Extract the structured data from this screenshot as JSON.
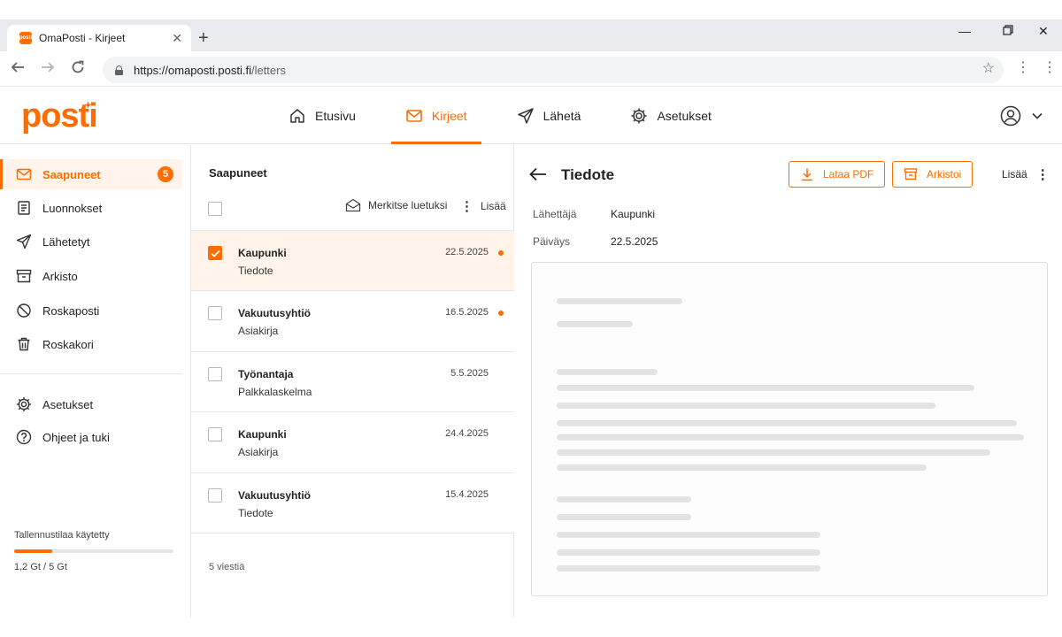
{
  "browser": {
    "tab_title": "OmaPosti - Kirjeet",
    "favicon_text": "posti",
    "url_host": "https://omaposti.posti.fi",
    "url_path": "/letters"
  },
  "header": {
    "logo": "posti",
    "nav": [
      {
        "label": "Etusivu",
        "icon": "home-icon"
      },
      {
        "label": "Kirjeet",
        "icon": "mail-icon",
        "active": true
      },
      {
        "label": "Lähetä",
        "icon": "send-icon"
      },
      {
        "label": "Asetukset",
        "icon": "gear-icon"
      }
    ]
  },
  "sidebar": {
    "items": [
      {
        "label": "Saapuneet",
        "icon": "mail-icon",
        "badge": "5",
        "active": true
      },
      {
        "label": "Luonnokset",
        "icon": "draft-icon"
      },
      {
        "label": "Lähetetyt",
        "icon": "send-icon"
      },
      {
        "label": "Arkisto",
        "icon": "archive-icon"
      },
      {
        "label": "Roskaposti",
        "icon": "block-icon"
      },
      {
        "label": "Roskakori",
        "icon": "trash-icon"
      },
      {
        "label": "Asetukset",
        "icon": "gear-icon"
      },
      {
        "label": "Ohjeet ja tuki",
        "icon": "help-icon"
      }
    ],
    "storage": {
      "label": "Tallennustilaa käytetty",
      "value": "1,2 Gt / 5 Gt",
      "used_fraction": 0.24
    }
  },
  "list": {
    "title": "Saapuneet",
    "mark_read": "Merkitse luetuksi",
    "more": "Lisää",
    "rows": [
      {
        "sender": "Kaupunki",
        "subject": "Tiedote",
        "date": "22.5.2025",
        "unread": true,
        "checked": true,
        "selected": true
      },
      {
        "sender": "Vakuutusyhtiö",
        "subject": "Asiakirja",
        "date": "16.5.2025",
        "unread": true,
        "checked": false
      },
      {
        "sender": "Työnantaja",
        "subject": "Palkkalaskelma",
        "date": "5.5.2025",
        "unread": false,
        "checked": false
      },
      {
        "sender": "Kaupunki",
        "subject": "Asiakirja",
        "date": "24.4.2025",
        "unread": false,
        "checked": false
      },
      {
        "sender": "Vakuutusyhtiö",
        "subject": "Tiedote",
        "date": "15.4.2025",
        "unread": false,
        "checked": false
      }
    ],
    "count": "5 viestiä"
  },
  "detail": {
    "title": "Tiedote",
    "download": "Lataa PDF",
    "archive": "Arkistoi",
    "more": "Lisää",
    "sender_label": "Lähettäjä",
    "sender": "Kaupunki",
    "date_label": "Päiväys",
    "date": "22.5.2025"
  },
  "colors": {
    "accent": "#ff6c00",
    "selected_bg": "#fff3ea"
  }
}
